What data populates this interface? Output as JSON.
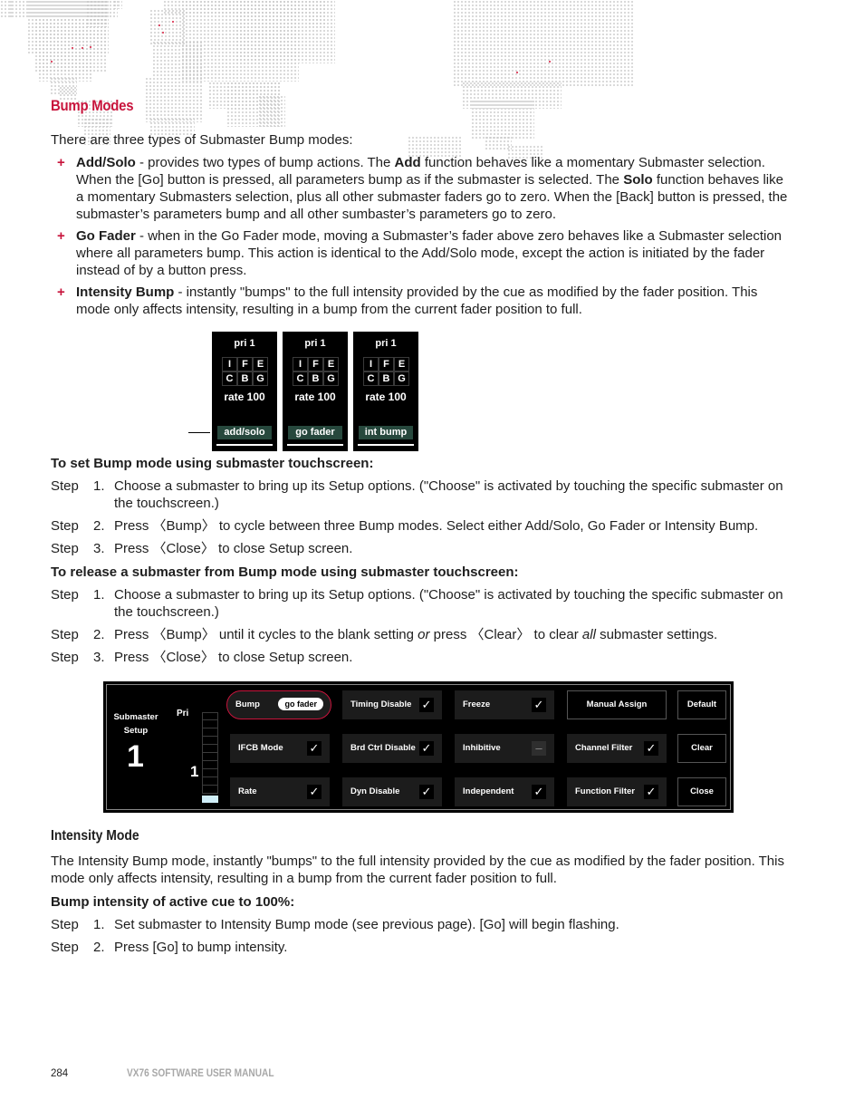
{
  "section_title": "Bump Modes",
  "intro": "There are three types of Submaster Bump modes:",
  "bullets": [
    {
      "term": "Add/Solo",
      "text_parts": [
        " - provides two types of bump actions. The ",
        "Add",
        " function behaves like a momentary Submaster selection. When the [Go] button is pressed, all parameters bump as if the submaster is selected. The ",
        "Solo",
        " function behaves like a momentary Submasters selection, plus all other submaster faders go to zero. When the [Back] button is pressed, the submaster’s parameters bump and all other sumbaster’s parameters go to zero."
      ]
    },
    {
      "term": "Go Fader",
      "text": " - when in the Go Fader mode, moving a Submaster’s fader above zero behaves like a Submaster selection where all parameters bump. This action is identical to the Add/Solo mode, except the action is initiated by the fader instead of by a button press."
    },
    {
      "term": "Intensity Bump",
      "text": " - instantly \"bumps\" to the full intensity provided by the cue as modified by the fader position. This mode only affects intensity, resulting in a bump from the current fader position to full."
    }
  ],
  "bullet_marker": "+",
  "fader_cards": [
    {
      "pri": "pri 1",
      "grid": [
        "I",
        "F",
        "E",
        "C",
        "B",
        "G"
      ],
      "rate": "rate 100",
      "mode": "add/solo"
    },
    {
      "pri": "pri 1",
      "grid": [
        "I",
        "F",
        "E",
        "C",
        "B",
        "G"
      ],
      "rate": "rate 100",
      "mode": "go fader"
    },
    {
      "pri": "pri 1",
      "grid": [
        "I",
        "F",
        "E",
        "C",
        "B",
        "G"
      ],
      "rate": "rate 100",
      "mode": "int bump"
    }
  ],
  "set_procedure": {
    "heading": "To set Bump mode using submaster touchscreen:",
    "steps": [
      {
        "label": "Step",
        "num": "1.",
        "text": "Choose a submaster to bring up its Setup options. (\"Choose\" is activated by touching the specific submaster on the touchscreen.)"
      },
      {
        "label": "Step",
        "num": "2.",
        "text": "Press 〈Bump〉 to cycle between three Bump modes. Select either Add/Solo, Go Fader or Intensity Bump."
      },
      {
        "label": "Step",
        "num": "3.",
        "text": "Press 〈Close〉 to close Setup screen."
      }
    ]
  },
  "release_procedure": {
    "heading": "To release a submaster from Bump mode using submaster touchscreen:",
    "steps": [
      {
        "label": "Step",
        "num": "1.",
        "text": "Choose a submaster to bring up its Setup options. (\"Choose\" is activated by touching the specific submaster on the touchscreen.)"
      },
      {
        "label": "Step",
        "num": "2.",
        "text_parts": [
          "Press 〈Bump〉 until it cycles to the blank setting ",
          "or",
          " press 〈Clear〉 to clear ",
          "all",
          " submaster settings."
        ]
      },
      {
        "label": "Step",
        "num": "3.",
        "text": "Press 〈Close〉 to close Setup screen."
      }
    ]
  },
  "setup_panel": {
    "title_line1": "Submaster",
    "title_line2": "Setup",
    "submaster_number": "1",
    "pri_label": "Pri",
    "pri_value": "1",
    "bump": {
      "label": "Bump",
      "value": "go fader"
    },
    "toggles": [
      {
        "label": "IFCB Mode",
        "state": "checked",
        "mark": "✓"
      },
      {
        "label": "Rate",
        "state": "checked",
        "mark": "✓"
      },
      {
        "label": "Timing Disable",
        "state": "checked",
        "mark": "✓"
      },
      {
        "label": "Brd Ctrl Disable",
        "state": "checked",
        "mark": "✓"
      },
      {
        "label": "Dyn Disable",
        "state": "checked",
        "mark": "✓"
      },
      {
        "label": "Freeze",
        "state": "checked",
        "mark": "✓"
      },
      {
        "label": "Inhibitive",
        "state": "unchecked",
        "mark": "–"
      },
      {
        "label": "Independent",
        "state": "checked",
        "mark": "✓"
      },
      {
        "label": "Channel Filter",
        "state": "checked",
        "mark": "✓"
      },
      {
        "label": "Function Filter",
        "state": "checked",
        "mark": "✓"
      }
    ],
    "buttons": {
      "manual_assign": "Manual Assign",
      "default": "Default",
      "clear": "Clear",
      "close": "Close"
    }
  },
  "intensity_mode": {
    "heading": "Intensity Mode",
    "body": "The Intensity Bump mode, instantly \"bumps\" to the full intensity provided by the cue as modified by the fader position. This mode only affects intensity, resulting in a bump from the current fader position to full.",
    "subheading": "Bump intensity of active cue to 100%:",
    "steps": [
      {
        "label": "Step",
        "num": "1.",
        "text": "Set submaster to Intensity Bump mode (see previous page). [Go] will begin flashing."
      },
      {
        "label": "Step",
        "num": "2.",
        "text": "Press [Go] to bump intensity."
      }
    ]
  },
  "footer": {
    "page_number": "284",
    "manual_title": "VX76 SOFTWARE USER MANUAL"
  },
  "colors": {
    "accent": "#c8143c",
    "mode_badge": "#27483d",
    "fader_lit": "#cfeef8",
    "footer_text": "#a8a8a8"
  }
}
